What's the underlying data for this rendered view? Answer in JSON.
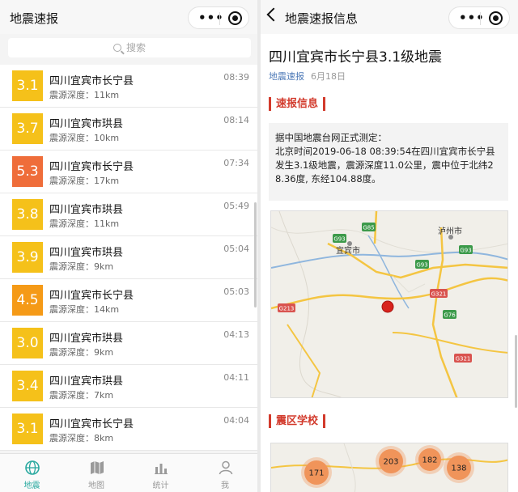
{
  "left": {
    "header": {
      "title": "地震速报"
    },
    "search": {
      "placeholder": "搜索"
    },
    "quakes": [
      {
        "mag": "3.1",
        "place": "四川宜宾市长宁县",
        "depth": "震源深度：11km",
        "time": "08:39",
        "color": "#f5c11a"
      },
      {
        "mag": "3.7",
        "place": "四川宜宾市珙县",
        "depth": "震源深度：10km",
        "time": "08:14",
        "color": "#f5c11a"
      },
      {
        "mag": "5.3",
        "place": "四川宜宾市长宁县",
        "depth": "震源深度：17km",
        "time": "07:34",
        "color": "#ef6d3a"
      },
      {
        "mag": "3.8",
        "place": "四川宜宾市珙县",
        "depth": "震源深度：11km",
        "time": "05:49",
        "color": "#f5c11a"
      },
      {
        "mag": "3.9",
        "place": "四川宜宾市珙县",
        "depth": "震源深度：9km",
        "time": "05:04",
        "color": "#f5c11a"
      },
      {
        "mag": "4.5",
        "place": "四川宜宾市长宁县",
        "depth": "震源深度：14km",
        "time": "05:03",
        "color": "#f59a17"
      },
      {
        "mag": "3.0",
        "place": "四川宜宾市珙县",
        "depth": "震源深度：9km",
        "time": "04:13",
        "color": "#f5c11a"
      },
      {
        "mag": "3.4",
        "place": "四川宜宾市珙县",
        "depth": "震源深度：7km",
        "time": "04:11",
        "color": "#f5c11a"
      },
      {
        "mag": "3.1",
        "place": "四川宜宾市长宁县",
        "depth": "震源深度：8km",
        "time": "04:04",
        "color": "#f5c11a"
      }
    ],
    "tabs": [
      {
        "label": "地震",
        "icon": "globe-icon",
        "active": true
      },
      {
        "label": "地图",
        "icon": "map-icon",
        "active": false
      },
      {
        "label": "统计",
        "icon": "bar-chart-icon",
        "active": false
      },
      {
        "label": "我",
        "icon": "person-icon",
        "active": false
      }
    ],
    "colors": {
      "accent": "#2aa9a0"
    }
  },
  "right": {
    "header": {
      "title": "地震速报信息"
    },
    "article": {
      "title": "四川宜宾市长宁县3.1级地震",
      "source": "地震速报",
      "date": "6月18日"
    },
    "section1": "速报信息",
    "info_lines": [
      "据中国地震台网正式测定：",
      "北京时间2019-06-18 08:39:54在四川宜宾市长宁县",
      "发生3.1级地震，震源深度11.0公里，震中位于北纬2",
      "8.36度, 东经104.88度。"
    ],
    "map": {
      "labels": [
        "泸州市",
        "宜宾市"
      ],
      "roads": [
        "G85",
        "G93",
        "G93",
        "G93",
        "G321",
        "G76",
        "G213",
        "G321"
      ]
    },
    "section2": "震区学校",
    "clusters": [
      "171",
      "203",
      "182",
      "138"
    ],
    "colors": {
      "accent": "#d23a2c",
      "marker": "#d8231d",
      "cluster": "#f0945a"
    }
  }
}
